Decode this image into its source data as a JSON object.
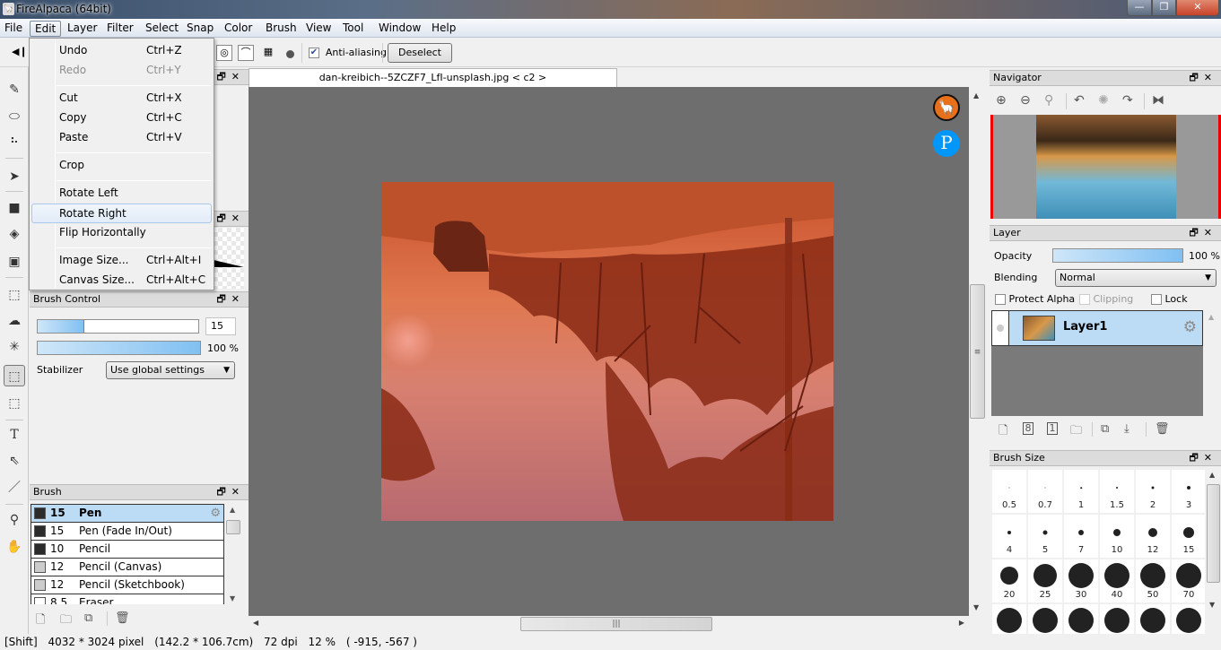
{
  "window": {
    "title": "FireAlpaca (64bit)",
    "controls": {
      "minimize": "—",
      "restore": "❐",
      "close": "✕"
    }
  },
  "menubar": [
    "File",
    "Edit",
    "Layer",
    "Filter",
    "Select",
    "Snap",
    "Color",
    "Brush",
    "View",
    "Tool",
    "Window",
    "Help"
  ],
  "active_menu": "Edit",
  "edit_menu": {
    "items": [
      {
        "label": "Undo",
        "shortcut": "Ctrl+Z",
        "disabled": false
      },
      {
        "label": "Redo",
        "shortcut": "Ctrl+Y",
        "disabled": true
      },
      {
        "label": "Cut",
        "shortcut": "Ctrl+X",
        "disabled": false
      },
      {
        "label": "Copy",
        "shortcut": "Ctrl+C",
        "disabled": false
      },
      {
        "label": "Paste",
        "shortcut": "Ctrl+V",
        "disabled": false
      },
      {
        "label": "Crop",
        "shortcut": "",
        "disabled": false
      },
      {
        "label": "Rotate Left",
        "shortcut": "",
        "disabled": false
      },
      {
        "label": "Rotate Right",
        "shortcut": "",
        "disabled": false,
        "highlighted": true
      },
      {
        "label": "Flip Horizontally",
        "shortcut": "",
        "disabled": false
      },
      {
        "label": "Image Size...",
        "shortcut": "Ctrl+Alt+I",
        "disabled": false
      },
      {
        "label": "Canvas Size...",
        "shortcut": "Ctrl+Alt+C",
        "disabled": false
      }
    ]
  },
  "toolbar": {
    "anti_aliasing_label": "Anti-aliasing",
    "anti_aliasing_checked": true,
    "deselect_label": "Deselect",
    "collapse_icon": "◀❙"
  },
  "document": {
    "tab_title": "dan-kreibich--5ZCZF7_LfI-unsplash.jpg < c2 >"
  },
  "brush_control": {
    "title": "Brush Control",
    "size_value": "15",
    "size_fraction": 0.29,
    "opacity_value": "100 %",
    "opacity_fraction": 1.0,
    "stabilizer_label": "Stabilizer",
    "stabilizer_value": "Use global settings"
  },
  "brush_panel": {
    "title": "Brush",
    "items": [
      {
        "size": "15",
        "name": "Pen",
        "color": "#2b2b2b",
        "selected": true
      },
      {
        "size": "15",
        "name": "Pen (Fade In/Out)",
        "color": "#2b2b2b"
      },
      {
        "size": "10",
        "name": "Pencil",
        "color": "#2b2b2b"
      },
      {
        "size": "12",
        "name": "Pencil (Canvas)",
        "color": "#cccccc"
      },
      {
        "size": "12",
        "name": "Pencil (Sketchbook)",
        "color": "#cccccc"
      },
      {
        "size": "8.5",
        "name": "Eraser",
        "color": "#ffffff"
      }
    ]
  },
  "navigator": {
    "title": "Navigator"
  },
  "layer_panel": {
    "title": "Layer",
    "opacity_label": "Opacity",
    "opacity_value": "100 %",
    "opacity_fraction": 1.0,
    "blending_label": "Blending",
    "blending_value": "Normal",
    "protect_alpha_label": "Protect Alpha",
    "clipping_label": "Clipping",
    "lock_label": "Lock",
    "layers": [
      {
        "name": "Layer1",
        "selected": true
      }
    ]
  },
  "brush_size_panel": {
    "title": "Brush Size",
    "sizes": [
      "0.5",
      "0.7",
      "1",
      "1.5",
      "2",
      "3",
      "4",
      "5",
      "7",
      "10",
      "12",
      "15",
      "20",
      "25",
      "30",
      "40",
      "50",
      "70",
      "",
      "",
      "",
      "",
      "",
      ""
    ]
  },
  "statusbar": {
    "modifier": "[Shift]",
    "dimensions": "4032 * 3024 pixel",
    "physical_size": "(142.2 * 106.7cm)",
    "dpi": "72 dpi",
    "zoom": "12 %",
    "cursor": "( -915, -567 )"
  },
  "colors": {
    "selection_blue": "#bcdcf6",
    "slider_fill": "#80c0f2",
    "canvas_bg": "#6e6e6e",
    "close_red": "#c8412a"
  }
}
